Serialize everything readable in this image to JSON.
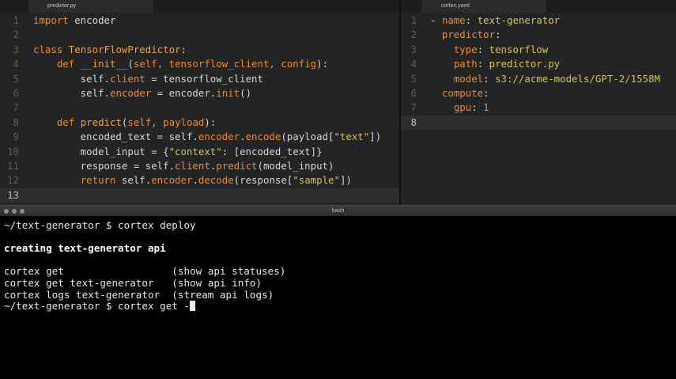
{
  "left_tab": {
    "label": "predictor.py"
  },
  "right_tab": {
    "label": "cortex.yaml"
  },
  "left_editor": {
    "lines": [
      {
        "num": "1",
        "tokens": [
          {
            "t": "kw",
            "v": "import"
          },
          {
            "t": "tx",
            "v": " encoder"
          }
        ]
      },
      {
        "num": "2",
        "tokens": []
      },
      {
        "num": "3",
        "tokens": [
          {
            "t": "kw",
            "v": "class"
          },
          {
            "t": "tx",
            "v": " "
          },
          {
            "t": "fn",
            "v": "TensorFlowPredictor"
          },
          {
            "t": "tx",
            "v": ":"
          }
        ]
      },
      {
        "num": "4",
        "tokens": [
          {
            "t": "tx",
            "v": "    "
          },
          {
            "t": "kw",
            "v": "def"
          },
          {
            "t": "tx",
            "v": " "
          },
          {
            "t": "fn",
            "v": "__init__"
          },
          {
            "t": "tx",
            "v": "("
          },
          {
            "t": "at",
            "v": "self, tensorflow_client, config"
          },
          {
            "t": "tx",
            "v": "):"
          }
        ]
      },
      {
        "num": "5",
        "tokens": [
          {
            "t": "tx",
            "v": "        self."
          },
          {
            "t": "at",
            "v": "client"
          },
          {
            "t": "tx",
            "v": " = tensorflow_client"
          }
        ]
      },
      {
        "num": "6",
        "tokens": [
          {
            "t": "tx",
            "v": "        self."
          },
          {
            "t": "at",
            "v": "encoder"
          },
          {
            "t": "tx",
            "v": " = encoder."
          },
          {
            "t": "at",
            "v": "init"
          },
          {
            "t": "tx",
            "v": "()"
          }
        ]
      },
      {
        "num": "7",
        "tokens": []
      },
      {
        "num": "8",
        "tokens": [
          {
            "t": "tx",
            "v": "    "
          },
          {
            "t": "kw",
            "v": "def"
          },
          {
            "t": "tx",
            "v": " "
          },
          {
            "t": "fn",
            "v": "predict"
          },
          {
            "t": "tx",
            "v": "("
          },
          {
            "t": "at",
            "v": "self, payload"
          },
          {
            "t": "tx",
            "v": "):"
          }
        ]
      },
      {
        "num": "9",
        "tokens": [
          {
            "t": "tx",
            "v": "        encoded_text = self."
          },
          {
            "t": "at",
            "v": "encoder"
          },
          {
            "t": "tx",
            "v": "."
          },
          {
            "t": "at",
            "v": "encode"
          },
          {
            "t": "tx",
            "v": "(payload["
          },
          {
            "t": "st",
            "v": "\"text\""
          },
          {
            "t": "tx",
            "v": "])"
          }
        ]
      },
      {
        "num": "10",
        "tokens": [
          {
            "t": "tx",
            "v": "        model_input = {"
          },
          {
            "t": "st",
            "v": "\"context\""
          },
          {
            "t": "tx",
            "v": ": [encoded_text]}"
          }
        ]
      },
      {
        "num": "11",
        "tokens": [
          {
            "t": "tx",
            "v": "        response = self."
          },
          {
            "t": "at",
            "v": "client"
          },
          {
            "t": "tx",
            "v": "."
          },
          {
            "t": "at",
            "v": "predict"
          },
          {
            "t": "tx",
            "v": "(model_input)"
          }
        ]
      },
      {
        "num": "12",
        "tokens": [
          {
            "t": "tx",
            "v": "        "
          },
          {
            "t": "kw",
            "v": "return"
          },
          {
            "t": "tx",
            "v": " self."
          },
          {
            "t": "at",
            "v": "encoder"
          },
          {
            "t": "tx",
            "v": "."
          },
          {
            "t": "at",
            "v": "decode"
          },
          {
            "t": "tx",
            "v": "(response["
          },
          {
            "t": "st",
            "v": "\"sample\""
          },
          {
            "t": "tx",
            "v": "])"
          }
        ]
      },
      {
        "num": "13",
        "tokens": [],
        "current": true
      }
    ]
  },
  "right_editor": {
    "lines": [
      {
        "num": "1",
        "tokens": [
          {
            "t": "tx",
            "v": "- "
          },
          {
            "t": "kw",
            "v": "name"
          },
          {
            "t": "tx",
            "v": ": "
          },
          {
            "t": "st",
            "v": "text-generator"
          }
        ]
      },
      {
        "num": "2",
        "tokens": [
          {
            "t": "tx",
            "v": "  "
          },
          {
            "t": "kw",
            "v": "predictor"
          },
          {
            "t": "tx",
            "v": ":"
          }
        ]
      },
      {
        "num": "3",
        "tokens": [
          {
            "t": "tx",
            "v": "    "
          },
          {
            "t": "kw",
            "v": "type"
          },
          {
            "t": "tx",
            "v": ": "
          },
          {
            "t": "st",
            "v": "tensorflow"
          }
        ]
      },
      {
        "num": "4",
        "tokens": [
          {
            "t": "tx",
            "v": "    "
          },
          {
            "t": "kw",
            "v": "path"
          },
          {
            "t": "tx",
            "v": ": "
          },
          {
            "t": "st",
            "v": "predictor.py"
          }
        ]
      },
      {
        "num": "5",
        "tokens": [
          {
            "t": "tx",
            "v": "    "
          },
          {
            "t": "kw",
            "v": "model"
          },
          {
            "t": "tx",
            "v": ": "
          },
          {
            "t": "st",
            "v": "s3://acme-models/GPT-2/1558M"
          }
        ]
      },
      {
        "num": "6",
        "tokens": [
          {
            "t": "tx",
            "v": "  "
          },
          {
            "t": "kw",
            "v": "compute"
          },
          {
            "t": "tx",
            "v": ":"
          }
        ]
      },
      {
        "num": "7",
        "tokens": [
          {
            "t": "tx",
            "v": "    "
          },
          {
            "t": "kw",
            "v": "gpu"
          },
          {
            "t": "tx",
            "v": ": "
          },
          {
            "t": "nm",
            "v": "1"
          }
        ]
      },
      {
        "num": "8",
        "tokens": [],
        "current": true
      }
    ]
  },
  "terminal": {
    "title": "bash",
    "lines": [
      {
        "text": "~/text-generator $ cortex deploy",
        "bold": false
      },
      {
        "text": "",
        "bold": false
      },
      {
        "text": "creating text-generator api",
        "bold": true
      },
      {
        "text": "",
        "bold": false
      },
      {
        "text": "cortex get                  (show api statuses)",
        "bold": false
      },
      {
        "text": "cortex get text-generator   (show api info)",
        "bold": false
      },
      {
        "text": "cortex logs text-generator  (stream api logs)",
        "bold": false
      },
      {
        "text": "~/text-generator $ cortex get -",
        "bold": false,
        "cursor": true
      }
    ]
  }
}
